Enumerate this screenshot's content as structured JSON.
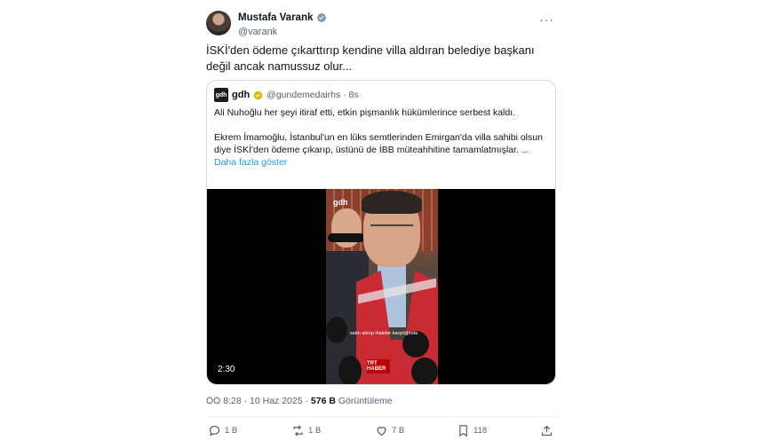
{
  "author": {
    "name": "Mustafa Varank",
    "handle": "@varank",
    "more": "···"
  },
  "tweet": {
    "text": "İSKİ'den ödeme çıkarttırıp kendine villa aldıran belediye başkanı değil ancak namussuz olur..."
  },
  "quote": {
    "logo": "gdh",
    "name": "gdh",
    "handle": "@gundemedairhs · 8s",
    "para1": "Ali Nuhoğlu her şeyi itiraf etti, etkin pişmanlık hükümlerince serbest kaldı.",
    "para2": "Ekrem İmamoğlu, İstanbul'un en lüks semtlerinden Emirgan'da villa sahibi olsun diye İSKİ'den ödeme çıkarıp, üstünü de İBB müteahhitine tamamlatmışlar. ...",
    "show_more": "Daha fazla göster",
    "video": {
      "duration": "2:30",
      "watermark": "gdh",
      "caption": "satın alınıp ihaleler karşılığında",
      "trt_label": "TRT HABER"
    }
  },
  "meta": {
    "time": "ÖÖ 8:28 · 10 Haz 2025 · ",
    "views_count": "576 B",
    "views_label": " Görüntüleme"
  },
  "actions": {
    "reply": "1 B",
    "retweet": "1 B",
    "like": "7 B",
    "bookmark": "118"
  },
  "colors": {
    "accent": "#1d9bf0",
    "muted": "#536471",
    "text": "#0f1419",
    "border": "#cfd9de",
    "verified_gold": "#e2b719"
  }
}
